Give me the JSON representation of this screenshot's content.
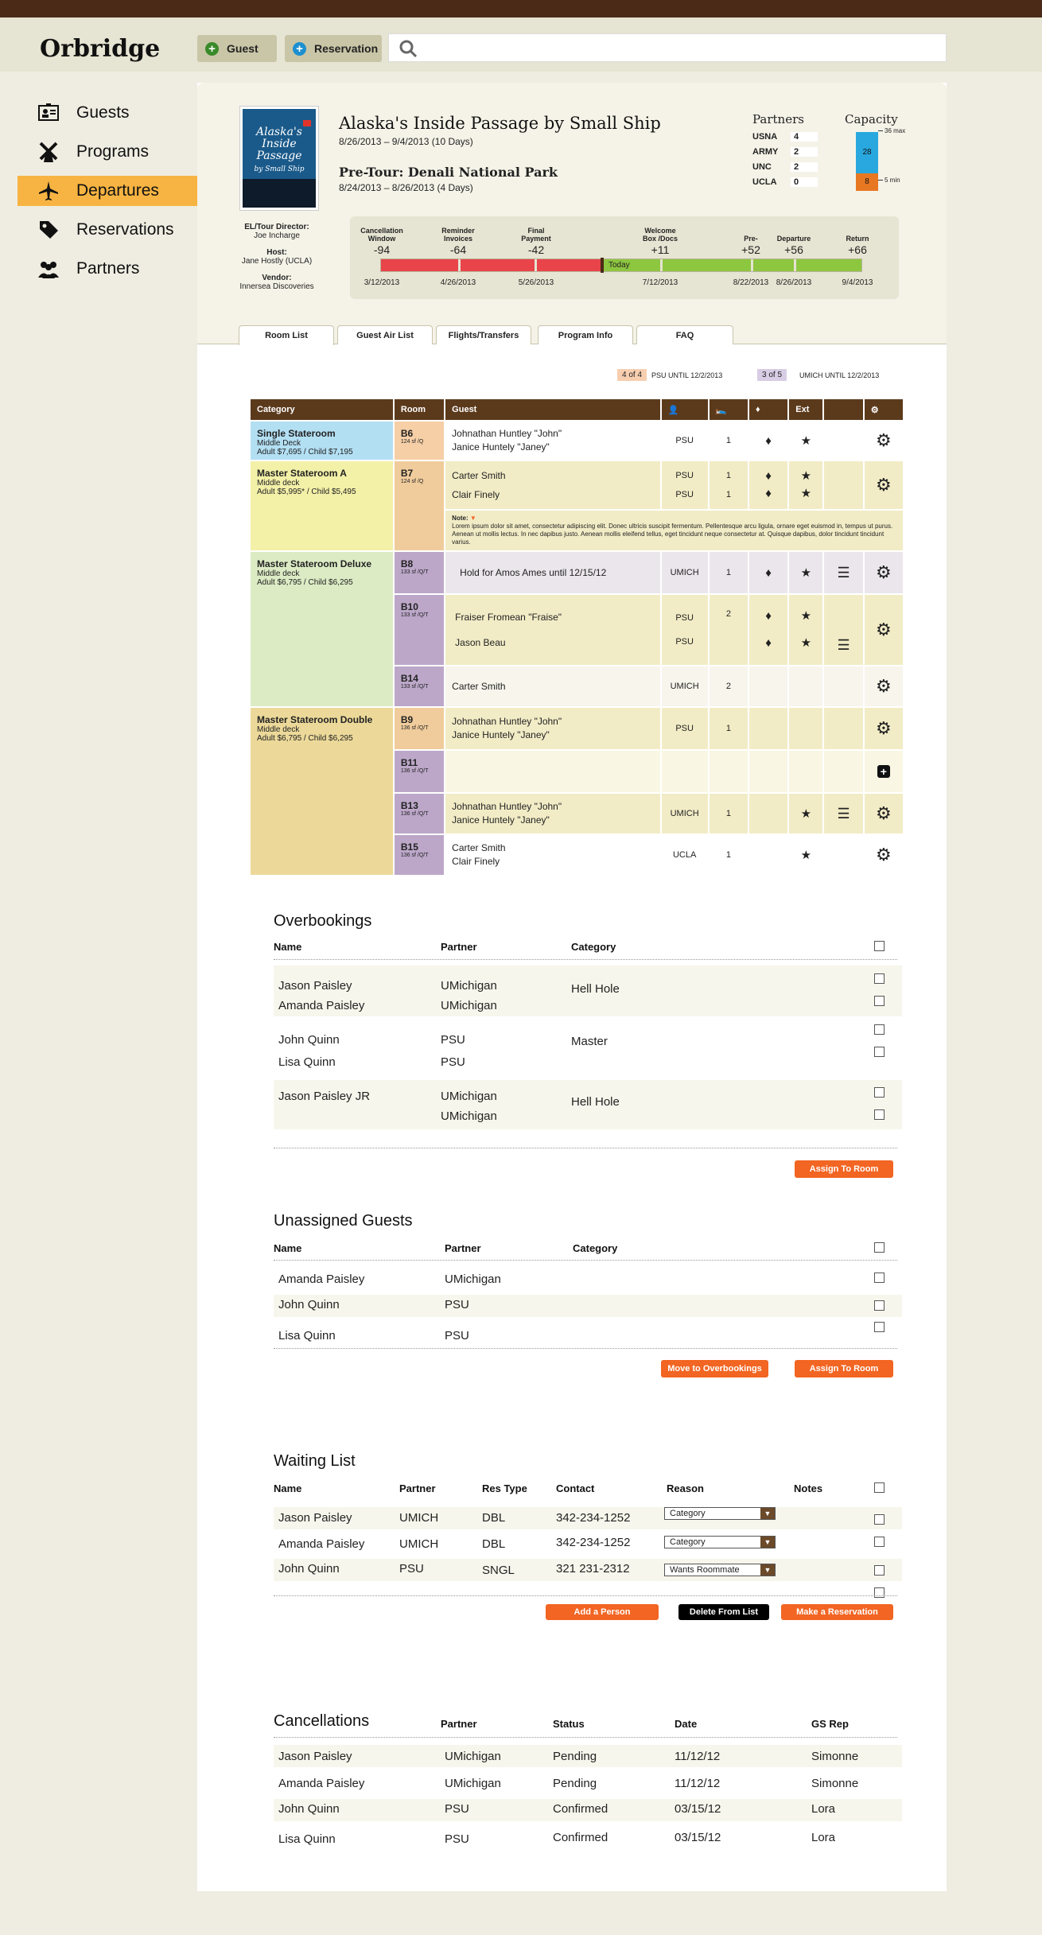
{
  "app": {
    "name": "Orbridge"
  },
  "header": {
    "guest_button": "Guest",
    "reservation_button": "Reservation",
    "search_placeholder": ""
  },
  "sidebar": {
    "items": [
      {
        "label": "Guests",
        "icon": "id-card-icon"
      },
      {
        "label": "Programs",
        "icon": "windmill-icon"
      },
      {
        "label": "Departures",
        "icon": "airplane-icon",
        "active": true
      },
      {
        "label": "Reservations",
        "icon": "tag-icon"
      },
      {
        "label": "Partners",
        "icon": "people-icon"
      }
    ]
  },
  "program": {
    "book_title": "Alaska's Inside Passage",
    "book_subtitle": "by Small Ship",
    "title": "Alaska's Inside Passage by Small Ship",
    "dates": "8/26/2013 – 9/4/2013  (10 Days)",
    "pretour_title": "Pre-Tour: Denali National Park",
    "pretour_dates": "8/24/2013  – 8/26/2013 (4 Days)",
    "director_label": "EL/Tour Director:",
    "director": "Joe Incharge",
    "host_label": "Host:",
    "host": "Jane Hostly (UCLA)",
    "vendor_label": "Vendor:",
    "vendor": "Innersea Discoveries"
  },
  "partners": {
    "heading": "Partners",
    "rows": [
      {
        "name": "USNA",
        "count": "4"
      },
      {
        "name": "ARMY",
        "count": "2"
      },
      {
        "name": "UNC",
        "count": "2"
      },
      {
        "name": "UCLA",
        "count": "0"
      }
    ]
  },
  "capacity": {
    "heading": "Capacity",
    "max_label": "36 max",
    "min_label": "5 min",
    "booked": "28",
    "min_value": "8",
    "booked_color": "#29a8df",
    "min_color": "#e87722"
  },
  "timeline": {
    "milestones": [
      {
        "label": "Cancellation\nWindow",
        "value": "-94",
        "date": "3/12/2013"
      },
      {
        "label": "Reminder\nInvoices",
        "value": "-64",
        "date": "4/26/2013"
      },
      {
        "label": "Final\nPayment",
        "value": "-42",
        "date": "5/26/2013"
      },
      {
        "label": "Welcome\nBox /Docs",
        "value": "+11",
        "date": "7/12/2013"
      },
      {
        "label": "Pre-",
        "value": "+52",
        "date": "8/22/2013"
      },
      {
        "label": "Departure",
        "value": "+56",
        "date": "8/26/2013"
      },
      {
        "label": "Return",
        "value": "+66",
        "date": "9/4/2013"
      }
    ],
    "today_label": "Today",
    "past_color": "#e8444a",
    "future_color": "#8dc63f"
  },
  "tabs": [
    "Room List",
    "Guest Air List",
    "Flights/Transfers",
    "Program Info",
    "FAQ"
  ],
  "legend": {
    "psu_badge": "4 of 4",
    "psu_text": "PSU UNTIL 12/2/2013",
    "umich_badge": "3 of 5",
    "umich_text": "UMICH UNTIL 12/2/2013"
  },
  "room_table": {
    "headers": [
      "Category",
      "Room",
      "Guest",
      "",
      "",
      "",
      "Ext",
      "",
      ""
    ],
    "categories": [
      {
        "name": "Single Stateroom",
        "deck": "Middle Deck",
        "price": "Adult $7,695 / Child $7,195"
      },
      {
        "name": "Master Stateroom A",
        "deck": "Middle deck",
        "price": "Adult $5,995*  / Child $5,495"
      },
      {
        "name": "Master Stateroom Deluxe",
        "deck": "Middle deck",
        "price": "Adult $6,795 / Child $6,295"
      },
      {
        "name": "Master Stateroom Double",
        "deck": "Middle deck",
        "price": "Adult $6,795 / Child $6,295"
      }
    ],
    "rooms": [
      {
        "room": "B6",
        "sub": "124 sf /Q",
        "guests": [
          "Johnathan Huntley \"John\"",
          "Janice Huntely \"Janey\""
        ],
        "partner": "PSU",
        "beds": "1"
      },
      {
        "room": "B7",
        "sub": "124 sf /Q",
        "guests": [
          "Carter Smith",
          "Clair Finely"
        ],
        "partner": "PSU",
        "partner2": "PSU",
        "beds": "1",
        "beds2": "1"
      },
      {
        "room": "B8",
        "sub": "133 sf /Q/T",
        "guests": [
          "Hold for Amos Ames until 12/15/12"
        ],
        "partner": "UMICH",
        "beds": "1"
      },
      {
        "room": "B10",
        "sub": "133 sf /Q/T",
        "guests": [
          "Fraiser Fromean  \"Fraise\"",
          "Jason Beau"
        ],
        "partner": "PSU",
        "partner2": "PSU",
        "beds": "2"
      },
      {
        "room": "B14",
        "sub": "133 sf /Q/T",
        "guests": [
          "Carter Smith"
        ],
        "partner": "UMICH",
        "beds": "2"
      },
      {
        "room": "B9",
        "sub": "136 sf /Q/T",
        "guests": [
          "Johnathan Huntley \"John\"",
          "Janice Huntely \"Janey\""
        ],
        "partner": "PSU",
        "beds": "1"
      },
      {
        "room": "B11",
        "sub": "136 sf /Q/T",
        "guests": [],
        "partner": "",
        "beds": ""
      },
      {
        "room": "B13",
        "sub": "136 sf /Q/T",
        "guests": [
          "Johnathan Huntley \"John\"",
          "Janice Huntely \"Janey\""
        ],
        "partner": "UMICH",
        "beds": "1"
      },
      {
        "room": "B15",
        "sub": "136 sf /Q/T",
        "guests": [
          "Carter Smith",
          "Clair Finely"
        ],
        "partner": "UCLA",
        "beds": "1"
      }
    ],
    "note_label": "Note:",
    "note_text": "Lorem ipsum dolor sit amet, consectetur adipiscing elit. Donec ultricis suscipit fermentum. Pellentesque arcu ligula, ornare eget euismod in, tempus ut purus. Aenean ut mollis lectus. In nec dapibus justo. Aenean mollis eleifend tellus, eget tincidunt neque consectetur at. Quisque dapibus, dolor tincidunt tincidunt varius."
  },
  "overbookings": {
    "title": "Overbookings",
    "headers": [
      "Name",
      "Partner",
      "Category"
    ],
    "groups": [
      {
        "names": [
          "Jason Paisley",
          "Amanda Paisley"
        ],
        "partners": [
          "UMichigan",
          "UMichigan"
        ],
        "category": "Hell Hole"
      },
      {
        "names": [
          "John Quinn",
          "Lisa Quinn"
        ],
        "partners": [
          "PSU",
          "PSU"
        ],
        "category": "Master"
      },
      {
        "names": [
          "Jason Paisley JR",
          ""
        ],
        "partners": [
          "UMichigan",
          "UMichigan"
        ],
        "category": "Hell Hole"
      }
    ],
    "assign_button": "Assign To Room"
  },
  "unassigned": {
    "title": "Unassigned Guests",
    "headers": [
      "Name",
      "Partner",
      "Category"
    ],
    "rows": [
      {
        "name": "Amanda Paisley",
        "partner": "UMichigan"
      },
      {
        "name": "John Quinn",
        "partner": "PSU"
      },
      {
        "name": "Lisa Quinn",
        "partner": "PSU"
      }
    ],
    "move_button": "Move to Overbookings",
    "assign_button": "Assign To Room"
  },
  "waiting": {
    "title": "Waiting List",
    "headers": [
      "Name",
      "Partner",
      "Res Type",
      "Contact",
      "Reason",
      "Notes"
    ],
    "rows": [
      {
        "name": "Jason Paisley",
        "partner": "UMICH",
        "type": "DBL",
        "contact": "342-234-1252",
        "reason": "Category"
      },
      {
        "name": "Amanda Paisley",
        "partner": "UMICH",
        "type": "DBL",
        "contact": "342-234-1252",
        "reason": "Category"
      },
      {
        "name": "John Quinn",
        "partner": "PSU",
        "type": "SNGL",
        "contact": "321 231-2312",
        "reason": "Wants Roommate"
      }
    ],
    "add_button": "Add a Person",
    "delete_button": "Delete From List",
    "reserve_button": "Make a Reservation"
  },
  "cancellations": {
    "title": "Cancellations",
    "headers": [
      "Partner",
      "Status",
      "Date",
      "GS Rep"
    ],
    "rows": [
      {
        "name": "Jason Paisley",
        "partner": "UMichigan",
        "status": "Pending",
        "date": "11/12/12",
        "rep": "Simonne"
      },
      {
        "name": "Amanda Paisley",
        "partner": "UMichigan",
        "status": "Pending",
        "date": "11/12/12",
        "rep": "Simonne"
      },
      {
        "name": "John Quinn",
        "partner": "PSU",
        "status": "Confirmed",
        "date": "03/15/12",
        "rep": "Lora"
      },
      {
        "name": "Lisa Quinn",
        "partner": "PSU",
        "status": "Confirmed",
        "date": "03/15/12",
        "rep": "Lora"
      }
    ]
  }
}
